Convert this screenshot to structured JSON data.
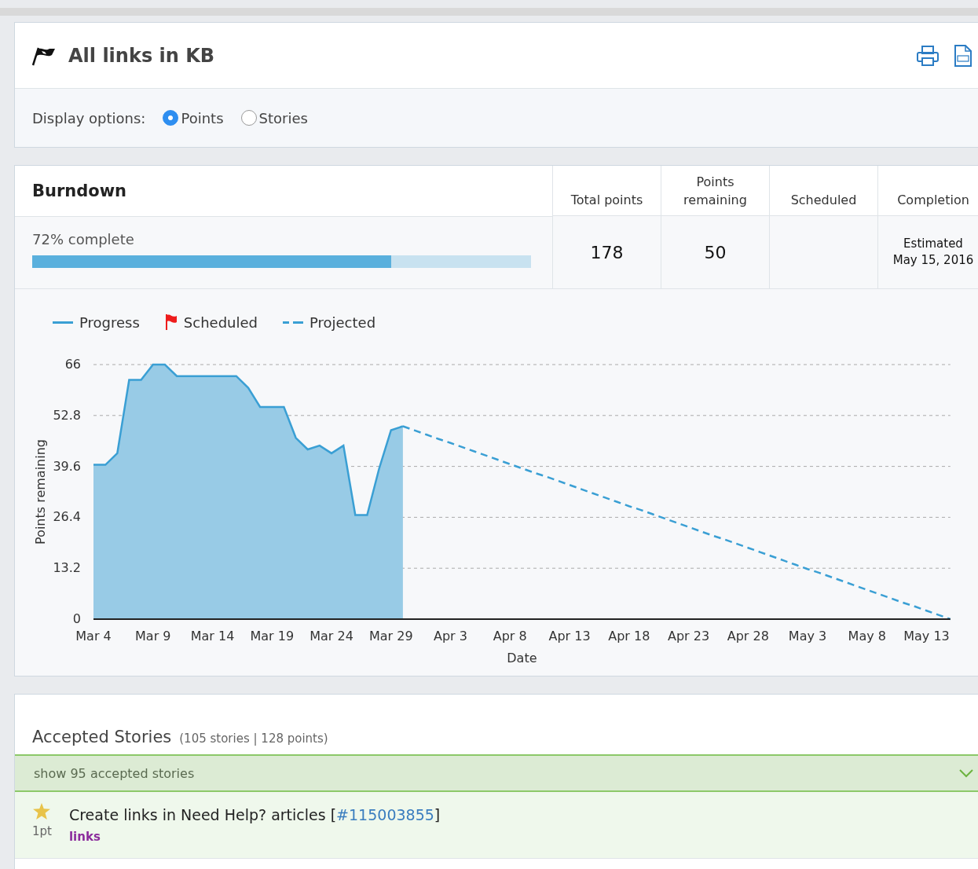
{
  "header": {
    "title": "All links in KB"
  },
  "display_options": {
    "label": "Display options:",
    "options": [
      {
        "label": "Points",
        "selected": true
      },
      {
        "label": "Stories",
        "selected": false
      }
    ]
  },
  "burndown": {
    "title": "Burndown",
    "progress_text": "72% complete",
    "level": 0.72,
    "columns": [
      {
        "heading": "Total points",
        "value": "178"
      },
      {
        "heading": "Points remaining",
        "value": "50"
      },
      {
        "heading": "Scheduled"
      },
      {
        "heading": "Completion",
        "value": "Estimated May 15, 2016"
      }
    ],
    "scheduled_marker": {
      "label": "Scheduled",
      "color": "#ee1c1c"
    },
    "chart_data": {
      "type": "line",
      "xlabel": "Date",
      "ylabel": "Points remaining",
      "categories": [
        "Mar 4",
        null,
        null,
        null,
        null,
        "Mar 9",
        null,
        null,
        null,
        null,
        "Mar 14",
        null,
        null,
        null,
        null,
        "Mar 19",
        null,
        null,
        null,
        null,
        "Mar 24",
        null,
        null,
        null,
        null,
        "Mar 29",
        null,
        null,
        null,
        null,
        "Apr 3",
        null,
        null,
        null,
        null,
        "Apr 8",
        null,
        null,
        null,
        null,
        "Apr 13",
        null,
        null,
        null,
        null,
        "Apr 18",
        null,
        null,
        null,
        null,
        "Apr 23",
        null,
        null,
        null,
        null,
        "Apr 28",
        null,
        null,
        null,
        null,
        "May 3",
        null,
        null,
        null,
        null,
        "May 8",
        null,
        null,
        null,
        null,
        "May 13",
        null,
        null
      ],
      "series": [
        {
          "name": "Progress",
          "color": "#3a9fd4",
          "line_style": "solid",
          "values": [
            40,
            40,
            43,
            62,
            62,
            66,
            66,
            63,
            63,
            63,
            63,
            63,
            63,
            60,
            55,
            55,
            55,
            47,
            44,
            45,
            43,
            45,
            27,
            27,
            39,
            49,
            50,
            null,
            null,
            null,
            null,
            null,
            null,
            null,
            null,
            null,
            null,
            null,
            null,
            null,
            null,
            null,
            null,
            null,
            null,
            null,
            null,
            null,
            null,
            null,
            null,
            null,
            null,
            null,
            null,
            null,
            null,
            null,
            null,
            null,
            null,
            null,
            null,
            null,
            null,
            null,
            null,
            null,
            null,
            null,
            null,
            null,
            null
          ]
        },
        {
          "name": "Projected",
          "color": "#3a9fd4",
          "line_style": "dashed",
          "values": [
            null,
            null,
            null,
            null,
            null,
            null,
            null,
            null,
            null,
            null,
            null,
            null,
            null,
            null,
            null,
            null,
            null,
            null,
            null,
            null,
            null,
            null,
            null,
            null,
            null,
            null,
            50,
            48.9,
            47.8,
            46.7,
            45.7,
            44.6,
            43.5,
            42.4,
            41.3,
            40.2,
            39.1,
            38,
            37,
            35.9,
            34.8,
            33.7,
            32.6,
            31.5,
            30.4,
            29.3,
            28.3,
            27.2,
            26.1,
            25,
            23.9,
            22.8,
            21.7,
            20.7,
            19.6,
            18.5,
            17.4,
            16.3,
            15.2,
            14.1,
            13,
            12,
            10.9,
            9.8,
            8.7,
            7.6,
            6.5,
            5.4,
            4.3,
            3.3,
            2.2,
            1.1,
            0
          ]
        }
      ],
      "grid": true,
      "legend": "top",
      "ylim": [
        0,
        66
      ],
      "yticks": [
        0,
        13.2,
        26.4,
        39.6,
        52.8,
        66
      ]
    }
  },
  "accepted": {
    "title": "Accepted Stories",
    "summary": "(105 stories | 128 points)",
    "toggle": "show 95 accepted stories",
    "stories": [
      {
        "title": "Create links in Need Help? articles [",
        "ref": "#115003855",
        "ref_close": "]",
        "points": "1pt",
        "tag": "links"
      }
    ]
  }
}
